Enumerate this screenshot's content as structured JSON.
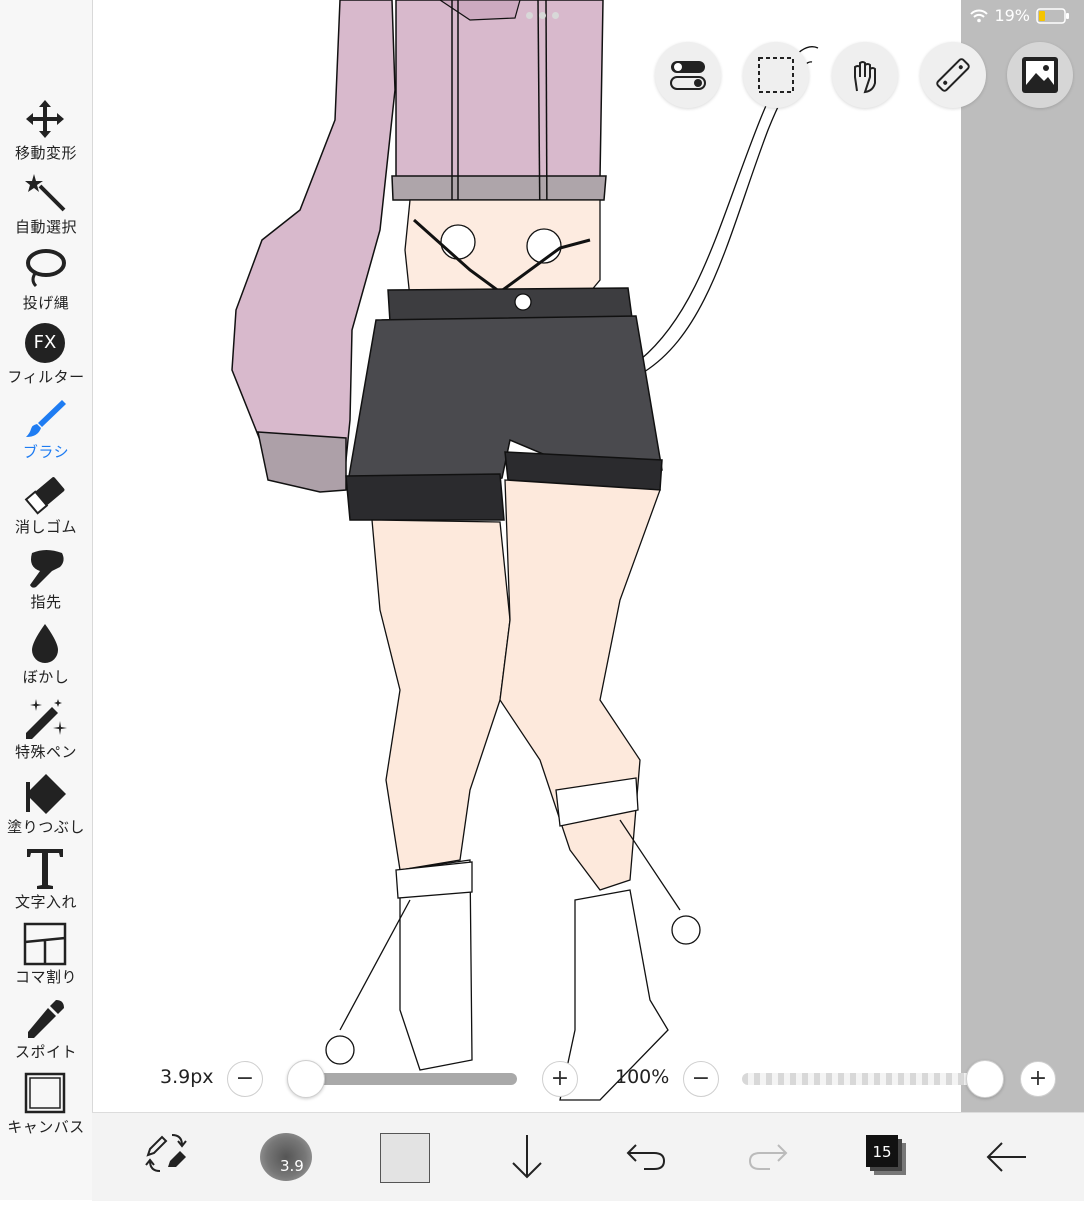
{
  "status": {
    "battery": "19%",
    "wifi_icon": "wifi-icon",
    "battery_icon": "battery-icon"
  },
  "tools": [
    {
      "label": "移動変形",
      "icon": "move-transform-icon",
      "active": false
    },
    {
      "label": "自動選択",
      "icon": "magic-wand-icon",
      "active": false
    },
    {
      "label": "投げ縄",
      "icon": "lasso-icon",
      "active": false
    },
    {
      "label": "フィルター",
      "icon": "fx-filter-icon",
      "active": false
    },
    {
      "label": "ブラシ",
      "icon": "brush-icon",
      "active": true
    },
    {
      "label": "消しゴム",
      "icon": "eraser-icon",
      "active": false
    },
    {
      "label": "指先",
      "icon": "finger-smudge-icon",
      "active": false
    },
    {
      "label": "ぼかし",
      "icon": "blur-drop-icon",
      "active": false
    },
    {
      "label": "特殊ペン",
      "icon": "special-pen-icon",
      "active": false
    },
    {
      "label": "塗りつぶし",
      "icon": "fill-bucket-icon",
      "active": false
    },
    {
      "label": "文字入れ",
      "icon": "text-icon",
      "active": false
    },
    {
      "label": "コマ割り",
      "icon": "frame-divider-icon",
      "active": false
    },
    {
      "label": "スポイト",
      "icon": "eyedropper-icon",
      "active": false
    },
    {
      "label": "キャンバス",
      "icon": "canvas-icon",
      "active": false
    }
  ],
  "fx_text": "FX",
  "top_buttons": [
    "toggle-icon",
    "selection-icon",
    "gesture-hand-icon",
    "ruler-icon",
    "layer-image-icon"
  ],
  "brush_size": {
    "label": "3.9px",
    "minus": "−",
    "plus": "+",
    "value_fraction": 0.0
  },
  "opacity": {
    "label": "100%",
    "minus": "−",
    "plus": "+",
    "value_fraction": 1.0
  },
  "bottom": {
    "brush_preview_label": "3.9",
    "layer_count": "15",
    "icons": [
      "swap-pen-eraser-icon",
      "brush-preview-icon",
      "color-swatch-icon",
      "download-arrow-icon",
      "undo-icon",
      "redo-icon",
      "layers-icon",
      "back-arrow-icon"
    ]
  },
  "colors": {
    "accent": "#1e7cf2",
    "hoodie": "#d8b9cc",
    "shorts": "#3a3a3c",
    "skin": "#fde9dc",
    "current_color": "#e3e3e3"
  }
}
